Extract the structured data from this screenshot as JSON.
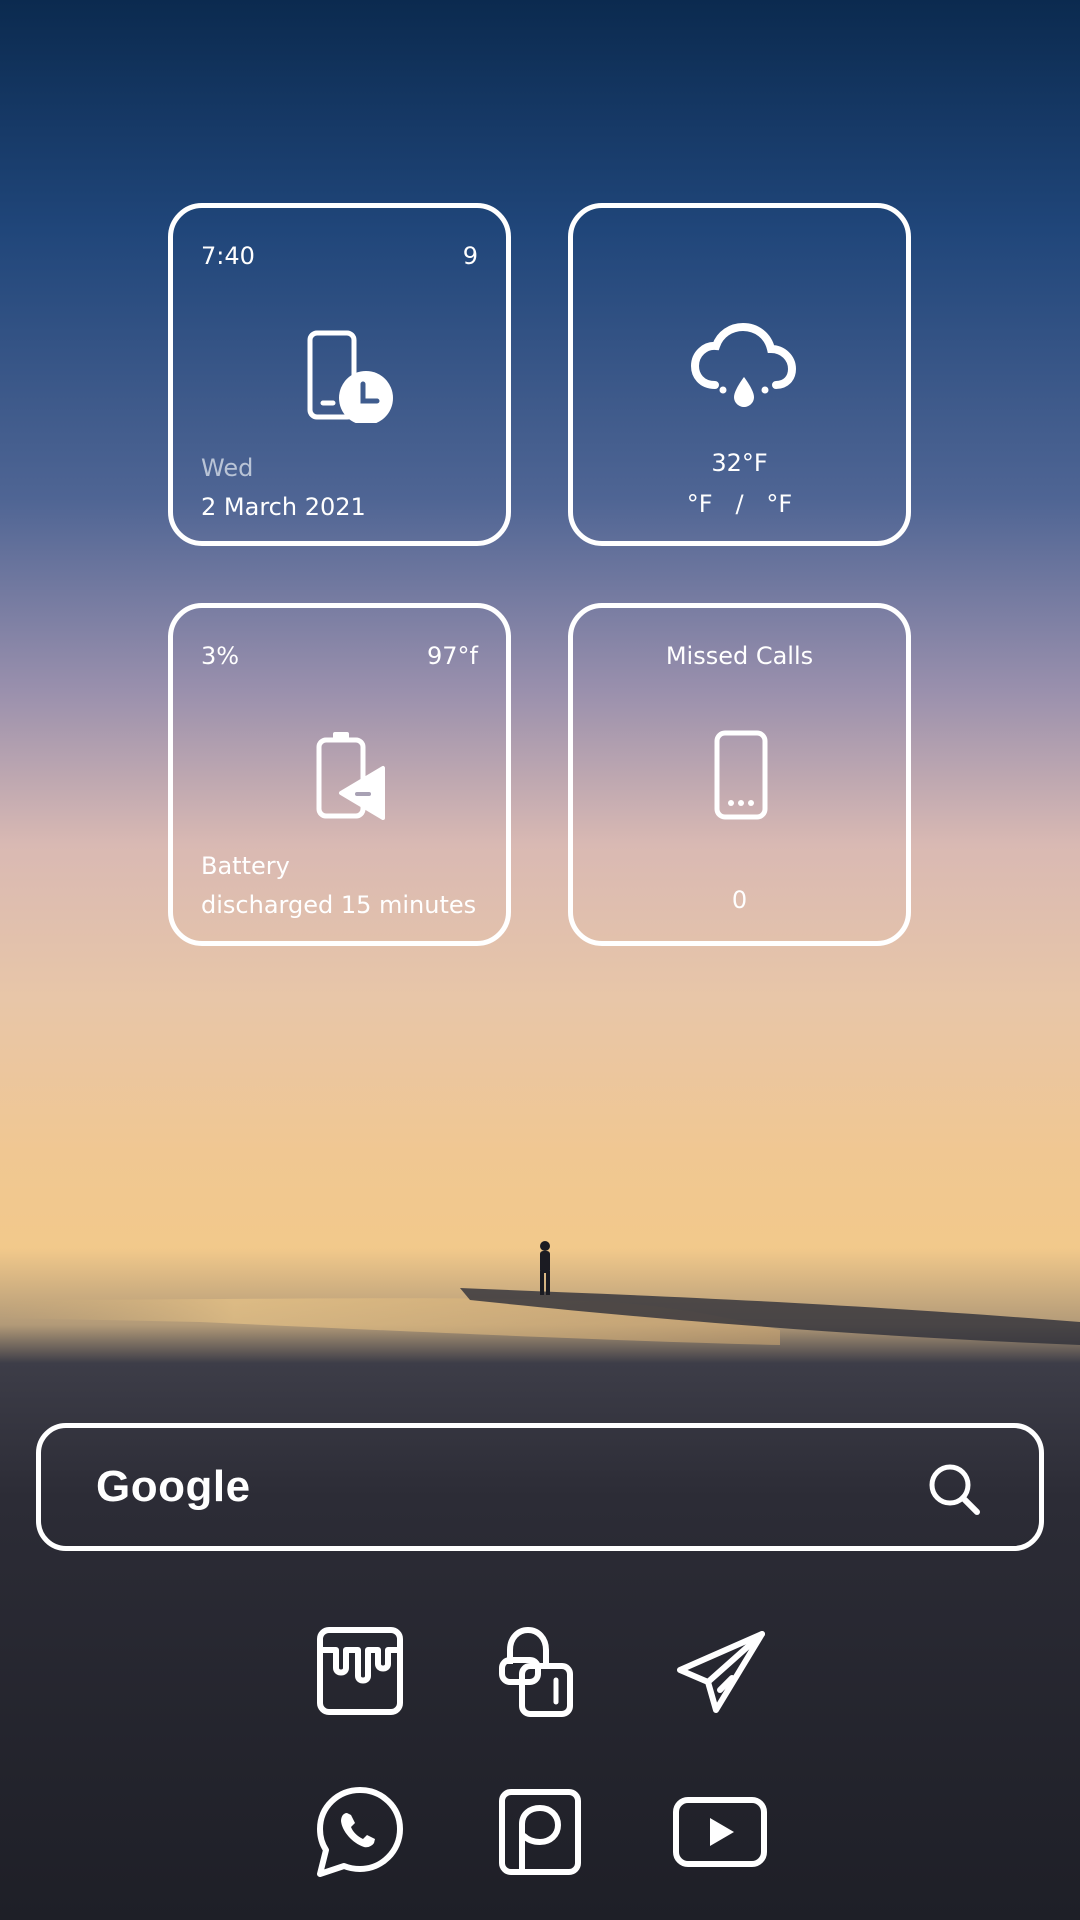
{
  "widgets": {
    "time": {
      "clock": "7:40",
      "corner_value": "9",
      "weekday": "Wed",
      "date": "2 March 2021",
      "icon": "phone-clock-icon"
    },
    "weather": {
      "temperature": "32°F",
      "range": "°F   /   °F",
      "icon": "cloud-rain-icon"
    },
    "battery": {
      "level": "3%",
      "temperature": "97°f",
      "label": "Battery",
      "status": "discharged 15 minutes",
      "icon": "battery-charging-icon"
    },
    "missed_calls": {
      "title": "Missed Calls",
      "count": "0",
      "icon": "phone-icon"
    }
  },
  "search": {
    "label": "Google",
    "icon": "search-icon"
  },
  "dock": {
    "row1": [
      "paint-bucket-icon",
      "lock-icon",
      "send-icon"
    ],
    "row2": [
      "whatsapp-icon",
      "picsart-icon",
      "youtube-icon"
    ]
  },
  "colors": {
    "foreground": "#ffffff",
    "muted_text": "#b9c4d6"
  }
}
